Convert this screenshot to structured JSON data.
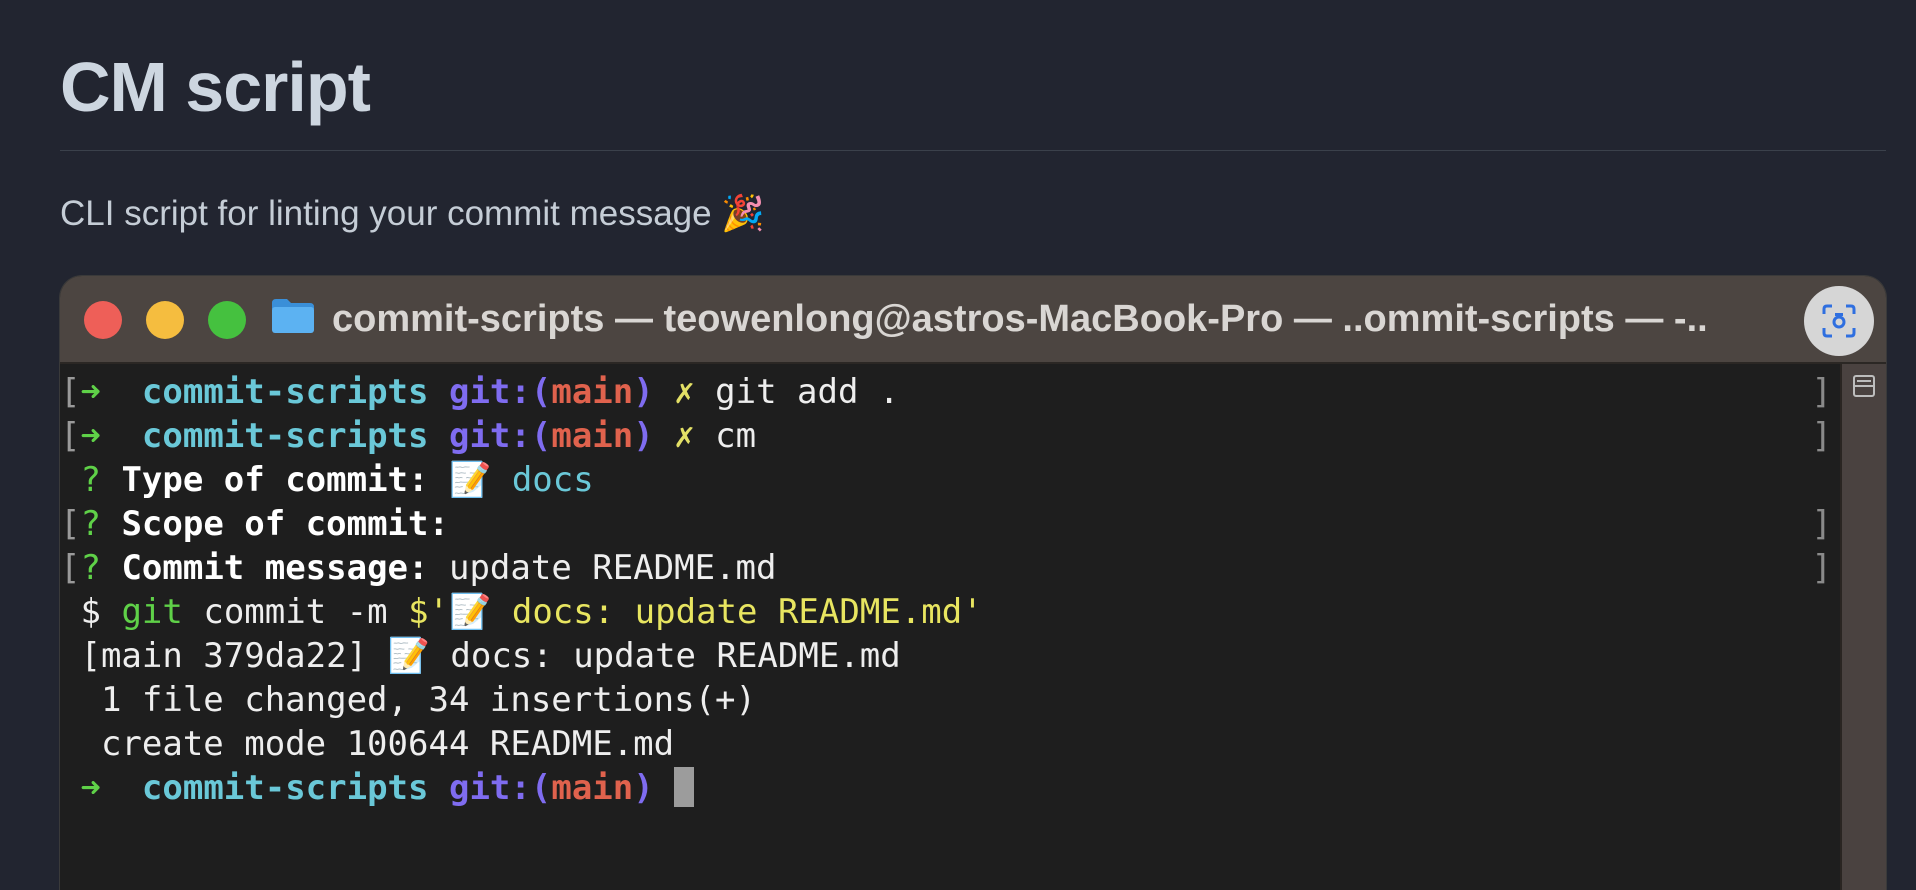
{
  "page": {
    "title": "CM script",
    "subtitle": "CLI script for linting your commit message",
    "subtitle_emoji": "🎉"
  },
  "terminal": {
    "window_title": "commit-scripts — teowenlong@astros-MacBook-Pro — ..ommit-scripts — -..",
    "folder_icon": "folder-icon",
    "traffic_lights": {
      "close": "#ee5f58",
      "minimize": "#f5bd3f",
      "zoom": "#45c13f"
    },
    "prompt": {
      "arrow": "➜",
      "dir": "commit-scripts",
      "git_label": "git:(",
      "branch": "main",
      "git_close": ")",
      "dirty": "✗"
    },
    "commands": {
      "add": "git add .",
      "cm": "cm"
    },
    "questions": {
      "mark": "?",
      "type_label": "Type of commit:",
      "type_value": "docs",
      "scope_label": "Scope of commit:",
      "message_label": "Commit message:",
      "message_value": "update README.md"
    },
    "memo_emoji": "📝",
    "exec": {
      "dollar": "$",
      "git": "git",
      "args": "commit -m",
      "quoted_start": "$'",
      "quoted_text": "docs: update README.md'"
    },
    "output": {
      "commit_head": "[main 379da22]",
      "commit_msg": "docs: update README.md",
      "changes": " 1 file changed, 34 insertions(+)",
      "create": " create mode 100644 README.md"
    }
  }
}
